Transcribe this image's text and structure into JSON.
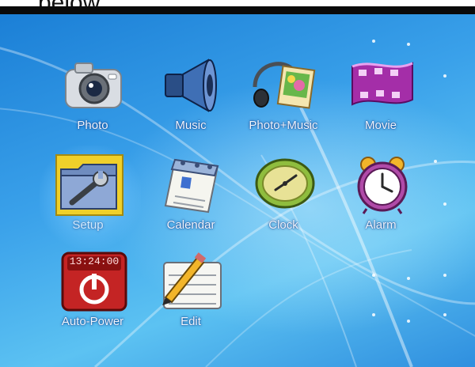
{
  "caption": "below.",
  "menu": {
    "items": [
      {
        "id": "photo",
        "label": "Photo"
      },
      {
        "id": "music",
        "label": "Music"
      },
      {
        "id": "photo_music",
        "label": "Photo+Music"
      },
      {
        "id": "movie",
        "label": "Movie"
      },
      {
        "id": "setup",
        "label": "Setup",
        "selected": true
      },
      {
        "id": "calendar",
        "label": "Calendar"
      },
      {
        "id": "clock",
        "label": "Clock"
      },
      {
        "id": "alarm",
        "label": "Alarm"
      },
      {
        "id": "auto_power",
        "label": "Auto-Power",
        "time_display": "13:24:00"
      },
      {
        "id": "edit",
        "label": "Edit"
      }
    ]
  },
  "icons": {
    "photo": "camera-icon",
    "music": "speaker-icon",
    "photo_music": "headphones-photo-icon",
    "movie": "film-strip-icon",
    "setup": "folder-wrench-icon",
    "calendar": "calendar-icon",
    "clock": "clock-icon",
    "alarm": "alarm-clock-icon",
    "auto_power": "power-timer-icon",
    "edit": "notepad-pencil-icon"
  },
  "colors": {
    "screen_bg": "#3aa1ea",
    "label_text": "#f2f8ff",
    "selected_folder": "#f0d02a"
  }
}
